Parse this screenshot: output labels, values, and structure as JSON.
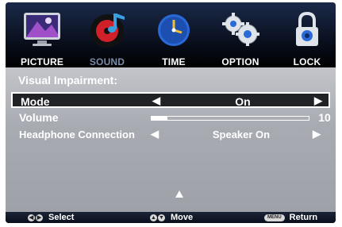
{
  "tabs": [
    {
      "label": "PICTURE",
      "icon": "monitor-icon",
      "selected": false
    },
    {
      "label": "SOUND",
      "icon": "music-disc-icon",
      "selected": true
    },
    {
      "label": "TIME",
      "icon": "clock-icon",
      "selected": false
    },
    {
      "label": "OPTION",
      "icon": "gears-icon",
      "selected": false
    },
    {
      "label": "LOCK",
      "icon": "padlock-icon",
      "selected": false
    }
  ],
  "panel": {
    "heading": "Visual Impairment:",
    "mode": {
      "label": "Mode",
      "value": "On",
      "left_arrow": "◀",
      "right_arrow": "▶"
    },
    "volume": {
      "label": "Volume",
      "value": "10",
      "level": 0.1
    },
    "headphone": {
      "label": "Headphone Connection",
      "value": "Speaker On",
      "left_arrow": "◀",
      "right_arrow": "▶"
    }
  },
  "footer": {
    "select_label": "Select",
    "move_label": "Move",
    "menu_key": "MENU",
    "return_label": "Return"
  },
  "colors": {
    "panel_bg": "#a8abb2",
    "selected_tab_text": "#7a8aa8",
    "text": "#ffffff"
  }
}
